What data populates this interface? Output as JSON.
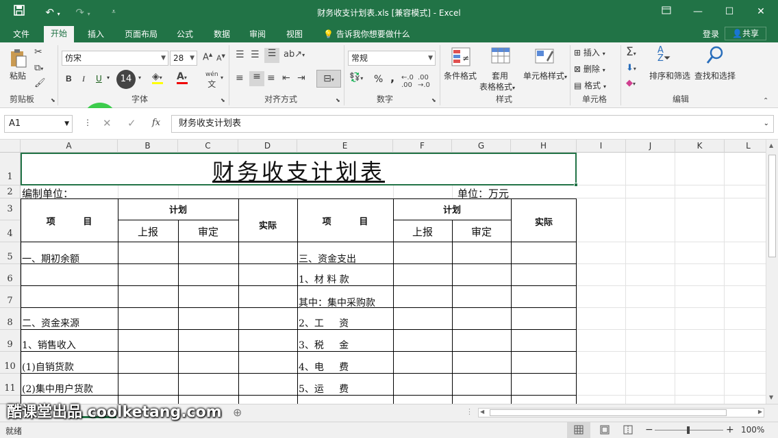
{
  "titlebar": {
    "title": "财务收支计划表.xls  [兼容模式] - Excel"
  },
  "tabs": [
    "文件",
    "开始",
    "插入",
    "页面布局",
    "公式",
    "数据",
    "审阅",
    "视图"
  ],
  "tell_me": "告诉我你想要做什么",
  "login": "登录",
  "share": "共享",
  "ribbon": {
    "paste": "粘贴",
    "clipboard": "剪贴板",
    "font_name": "仿宋",
    "font_size": "28",
    "font_group": "字体",
    "size_badge": "14",
    "bold": "B",
    "italic": "I",
    "underline": "U",
    "wen": "wén",
    "align_group": "对齐方式",
    "number_format": "常规",
    "percent": "%",
    "comma": ",",
    "number_group": "数字",
    "cond_format": "条件格式",
    "table_format_1": "套用",
    "table_format_2": "表格格式",
    "cell_styles": "单元格样式",
    "styles_group": "样式",
    "insert": "插入",
    "delete": "删除",
    "format": "格式",
    "cells_group": "单元格",
    "sort_filter": "排序和筛选",
    "find_select": "查找和选择",
    "editing_group": "编辑"
  },
  "formula_bar": {
    "name_box": "A1",
    "fx": "fx",
    "content": "财务收支计划表"
  },
  "columns": [
    "A",
    "B",
    "C",
    "D",
    "E",
    "F",
    "G",
    "H",
    "I",
    "J",
    "K",
    "L"
  ],
  "rows": [
    "1",
    "2",
    "3",
    "4",
    "5",
    "6",
    "7",
    "8",
    "9",
    "10",
    "11"
  ],
  "sheet": {
    "title": "财务收支计划表",
    "unit_prefix": "编制单位：",
    "unit": "单位：万元",
    "item": "项         目",
    "plan": "计划",
    "reported": "上报",
    "approved": "审定",
    "actual": "实际",
    "left_items": [
      "一、期初余额",
      "",
      "",
      "二、资金来源",
      "1、销售收入",
      "(1)自销货款",
      "(2)集中用户货款"
    ],
    "right_items": [
      "三、资金支出",
      "1、材 料 款",
      "其中：集中采购款",
      "2、工     资",
      "3、税     金",
      "4、电     费",
      "5、运     费"
    ]
  },
  "watermark": "酷课堂出品 coolketang.com",
  "status": {
    "ready": "就绪",
    "zoom": "100%"
  },
  "colors": {
    "excel_green": "#217346",
    "cursor_green": "#28c83a"
  }
}
